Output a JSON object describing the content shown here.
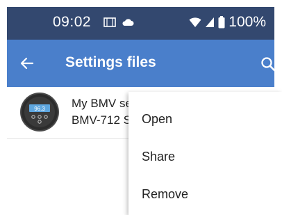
{
  "status_bar": {
    "time": "09:02",
    "battery": "100%",
    "icons": [
      "screen-cast-icon",
      "cloud-icon",
      "wifi-icon",
      "signal-icon",
      "battery-icon"
    ]
  },
  "app_bar": {
    "title": "Settings files",
    "icons": [
      "back-arrow-icon",
      "search-icon"
    ]
  },
  "file_list": [
    {
      "name": "My BMV se",
      "model": "BMV-712 S",
      "thumbnail": "bmv-device-thumbnail",
      "display_value": "96.3"
    }
  ],
  "context_menu": {
    "items": [
      "Open",
      "Share",
      "Remove"
    ]
  },
  "colors": {
    "status_bar": "#33486f",
    "app_bar": "#4a7fcb",
    "background": "#ffffff",
    "device_screen": "#5ea6df"
  }
}
